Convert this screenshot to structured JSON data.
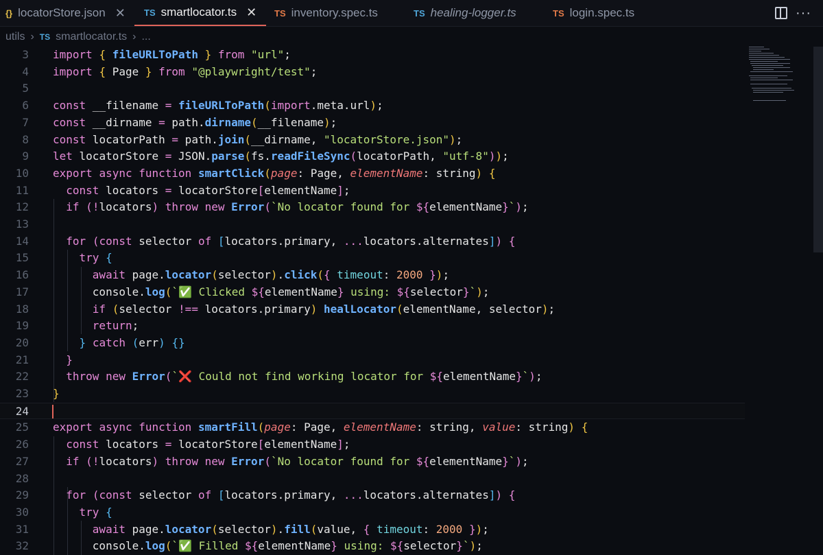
{
  "tabs": [
    {
      "icon": "{}",
      "icon_kind": "json",
      "label": "locatorStore.json",
      "active": false,
      "closable": true
    },
    {
      "icon": "TS",
      "icon_kind": "ts",
      "label": "smartlocator.ts",
      "active": true,
      "closable": true
    },
    {
      "icon": "TS",
      "icon_kind": "ts-orange",
      "label": "inventory.spec.ts",
      "active": false,
      "closable": false
    },
    {
      "icon": "TS",
      "icon_kind": "ts",
      "label": "healing-logger.ts",
      "active": false,
      "closable": false,
      "italic": true
    },
    {
      "icon": "TS",
      "icon_kind": "ts-orange",
      "label": "login.spec.ts",
      "active": false,
      "closable": false
    }
  ],
  "tab_close_glyph": "✕",
  "more_glyph": "···",
  "breadcrumb": {
    "folder": "utils",
    "sep": "›",
    "file_icon": "TS",
    "file": "smartlocator.ts",
    "tail": "..."
  },
  "lines": [
    {
      "n": "3"
    },
    {
      "n": "4"
    },
    {
      "n": "5"
    },
    {
      "n": "6"
    },
    {
      "n": "7"
    },
    {
      "n": "8"
    },
    {
      "n": "9"
    },
    {
      "n": "10"
    },
    {
      "n": "11"
    },
    {
      "n": "12"
    },
    {
      "n": "13"
    },
    {
      "n": "14"
    },
    {
      "n": "15"
    },
    {
      "n": "16"
    },
    {
      "n": "17"
    },
    {
      "n": "18"
    },
    {
      "n": "19"
    },
    {
      "n": "20"
    },
    {
      "n": "21"
    },
    {
      "n": "22"
    },
    {
      "n": "23"
    },
    {
      "n": "24"
    },
    {
      "n": "25"
    },
    {
      "n": "26"
    },
    {
      "n": "27"
    },
    {
      "n": "28"
    },
    {
      "n": "29"
    },
    {
      "n": "30"
    },
    {
      "n": "31"
    },
    {
      "n": "32"
    }
  ],
  "current_line": "24",
  "colors": {
    "accent": "#e0645a",
    "background": "#0b0d12",
    "keyword": "#e68ad8",
    "function": "#6fb3ff",
    "string": "#b9df7a",
    "bracket": "#f2c744"
  }
}
